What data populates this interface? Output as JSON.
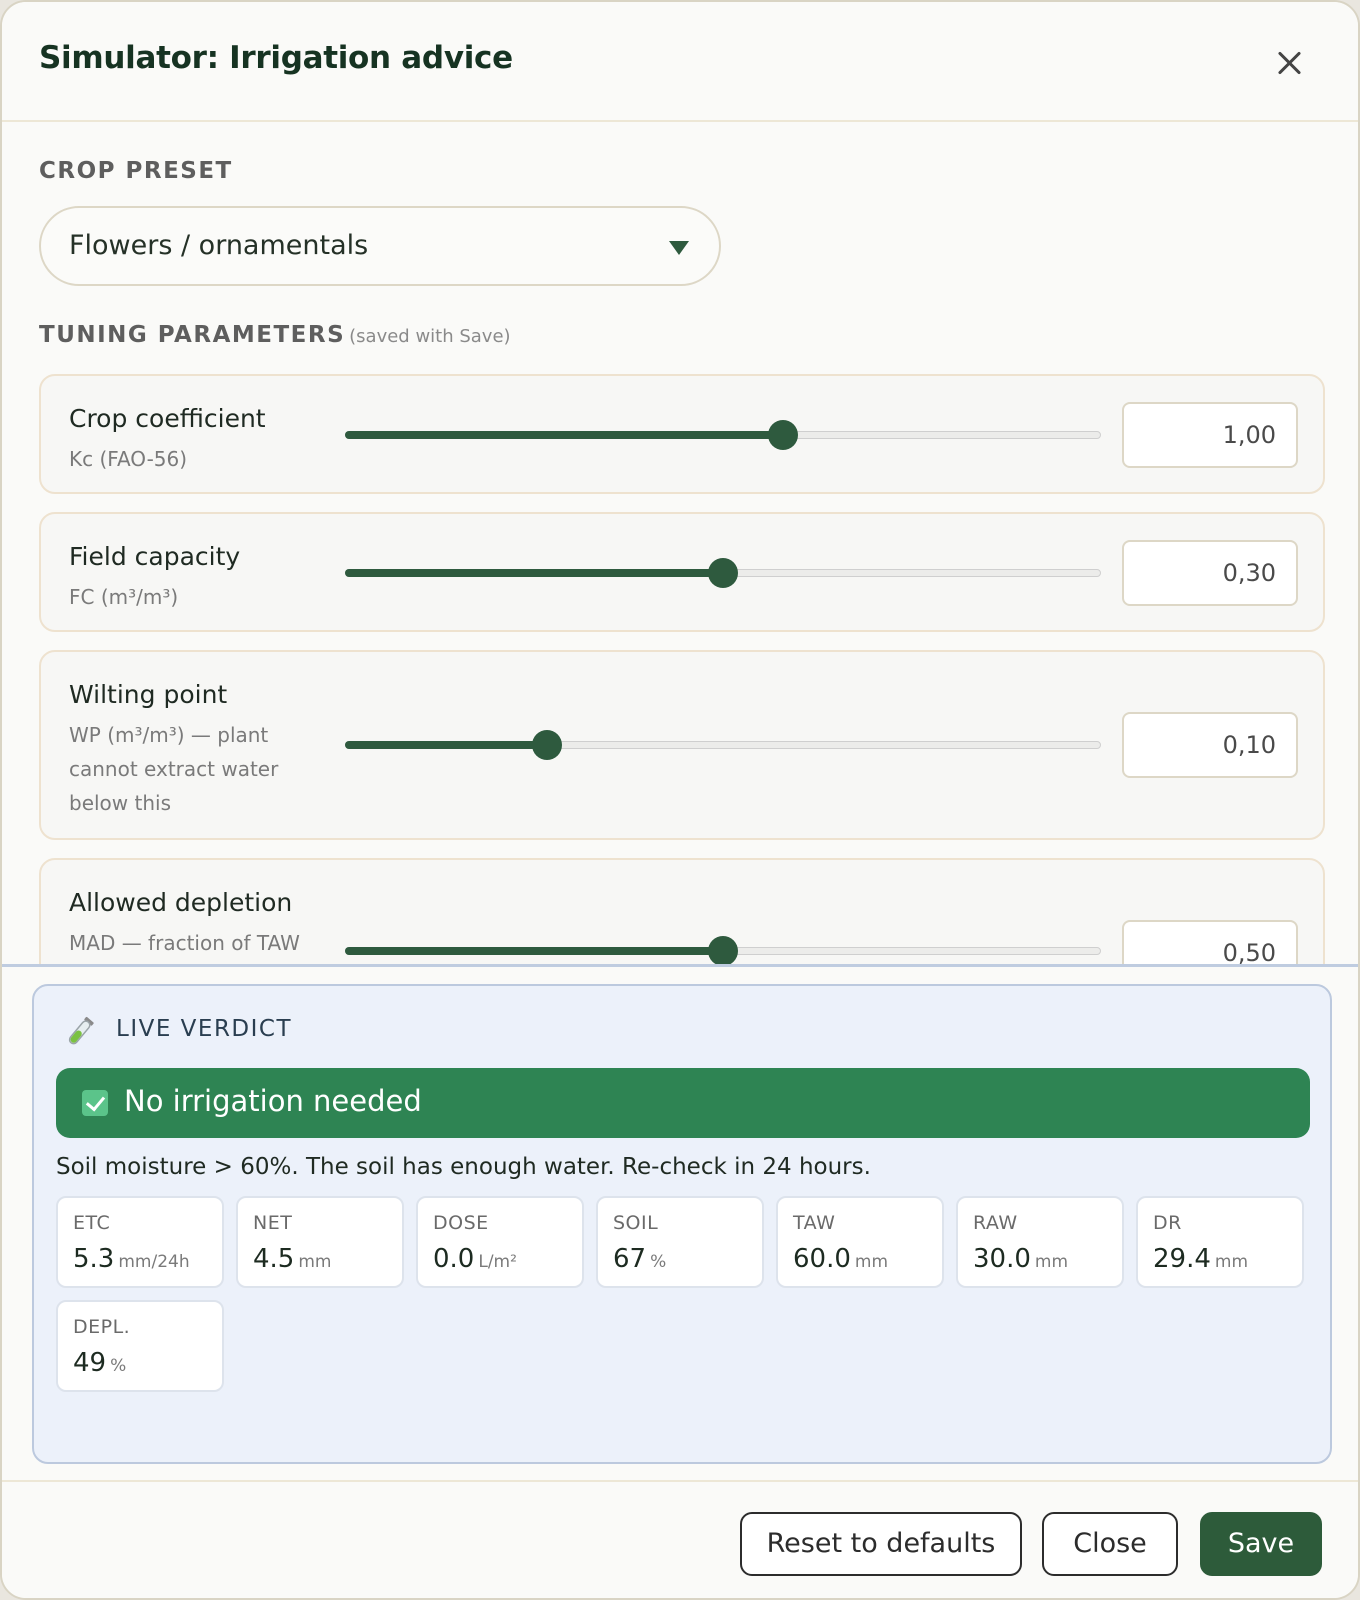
{
  "header": {
    "title": "Simulator: Irrigation advice",
    "close_icon": "close-icon"
  },
  "crop_preset": {
    "label": "CROP PRESET",
    "value": "Flowers / ornamentals"
  },
  "tuning": {
    "label": "TUNING PARAMETERS",
    "hint": "(saved with Save)",
    "params": [
      {
        "name": "Crop coefficient",
        "sub": "Kc (FAO-56)",
        "value": "1,00",
        "fraction": 0.58
      },
      {
        "name": "Field capacity",
        "sub": "FC (m³/m³)",
        "value": "0,30",
        "fraction": 0.5
      },
      {
        "name": "Wilting point",
        "sub": "WP (m³/m³) — plant cannot extract water below this",
        "value": "0,10",
        "fraction": 0.267
      },
      {
        "name": "Allowed depletion",
        "sub": "MAD — fraction of TAW",
        "value": "0,50",
        "fraction": 0.5
      }
    ]
  },
  "verdict": {
    "heading": "LIVE VERDICT",
    "icon": "test-tube-icon",
    "banner": "No irrigation needed",
    "banner_color": "#2e8453",
    "description": "Soil moisture > 60%. The soil has enough water. Re-check in 24 hours.",
    "metrics": [
      {
        "label": "ETC",
        "value": "5.3",
        "unit": "mm/24h"
      },
      {
        "label": "NET",
        "value": "4.5",
        "unit": "mm"
      },
      {
        "label": "DOSE",
        "value": "0.0",
        "unit": "L/m²"
      },
      {
        "label": "SOIL",
        "value": "67",
        "unit": "%"
      },
      {
        "label": "TAW",
        "value": "60.0",
        "unit": "mm"
      },
      {
        "label": "RAW",
        "value": "30.0",
        "unit": "mm"
      },
      {
        "label": "DR",
        "value": "29.4",
        "unit": "mm"
      },
      {
        "label": "DEPL.",
        "value": "49",
        "unit": "%"
      }
    ]
  },
  "footer": {
    "reset_label": "Reset to defaults",
    "close_label": "Close",
    "save_label": "Save"
  },
  "colors": {
    "accent": "#2e5a3e",
    "verdict_bg": "#ecf1fa",
    "primary_button": "#2d5b3a"
  }
}
